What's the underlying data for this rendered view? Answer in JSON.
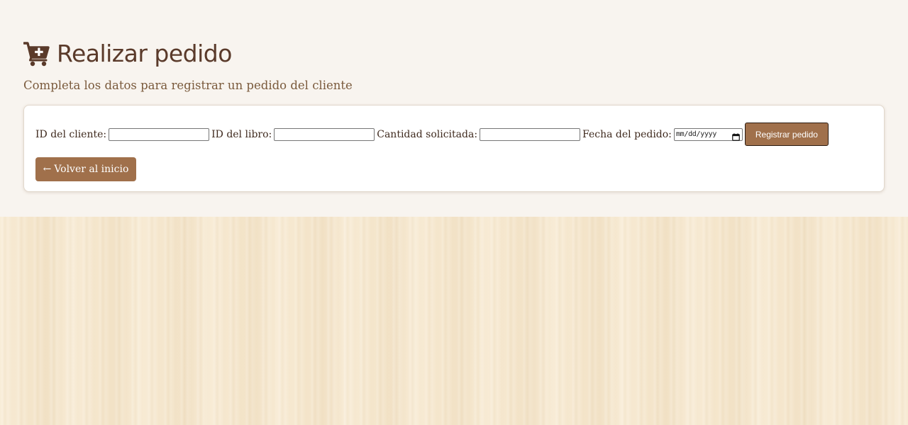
{
  "header": {
    "title": "Realizar pedido",
    "subtitle": "Completa los datos para registrar un pedido del cliente",
    "icon": "cart-plus-icon"
  },
  "form": {
    "fields": [
      {
        "label": "ID del cliente:",
        "value": "",
        "type": "text"
      },
      {
        "label": "ID del libro:",
        "value": "",
        "type": "text"
      },
      {
        "label": "Cantidad solicitada:",
        "value": "",
        "type": "number"
      },
      {
        "label": "Fecha del pedido:",
        "placeholder": "mm/dd/yyyy",
        "type": "date",
        "icon": "calendar-icon"
      }
    ],
    "submit_label": "Registrar pedido",
    "back_arrow": "←",
    "back_label": "Volver al inicio"
  },
  "colors": {
    "accent": "#a0704b",
    "title": "#5a3a2a",
    "subtitle": "#7a5a3c",
    "panel_background": "#f8f4ef",
    "page_background": "#f5e6cc"
  }
}
